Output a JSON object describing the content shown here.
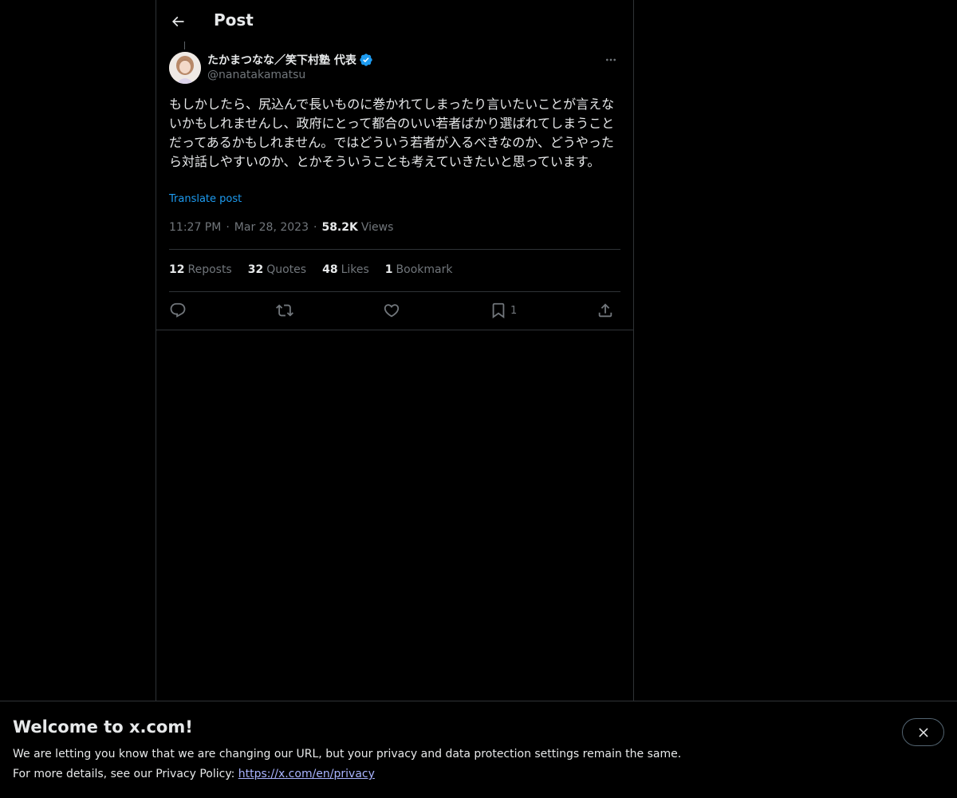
{
  "header": {
    "title": "Post",
    "back_icon": "arrow-left-icon"
  },
  "author": {
    "name": "たかまつなな／笑下村塾 代表",
    "handle": "@nanatakamatsu",
    "verified_color": "#1d9bf0"
  },
  "post": {
    "text": "もしかしたら、尻込んで長いものに巻かれてしまったり言いたいことが言えないかもしれませんし、政府にとって都合のいい若者ばかり選ばれてしまうことだってあるかもしれません。ではどういう若者が入るべきなのか、どうやったら対話しやすいのか、とかそういうことも考えていきたいと思っています。",
    "translate_label": "Translate post",
    "time": "11:27 PM",
    "date": "Mar 28, 2023",
    "separator": "·",
    "views_count": "58.2K",
    "views_label": "Views"
  },
  "stats": {
    "reposts": {
      "count": "12",
      "label": "Reposts"
    },
    "quotes": {
      "count": "32",
      "label": "Quotes"
    },
    "likes": {
      "count": "48",
      "label": "Likes"
    },
    "bookmarks": {
      "count": "1",
      "label": "Bookmark"
    }
  },
  "actions": {
    "bookmark_count": "1"
  },
  "banner": {
    "title": "Welcome to x.com!",
    "line1": "We are letting you know that we are changing our URL, but your privacy and data protection settings remain the same.",
    "line2_prefix": "For more details, see our Privacy Policy: ",
    "link": "https://x.com/en/privacy"
  },
  "colors": {
    "background": "#000000",
    "text_primary": "#e7e9ea",
    "text_secondary": "#71767b",
    "accent": "#1d9bf0",
    "border": "#2f3336"
  }
}
